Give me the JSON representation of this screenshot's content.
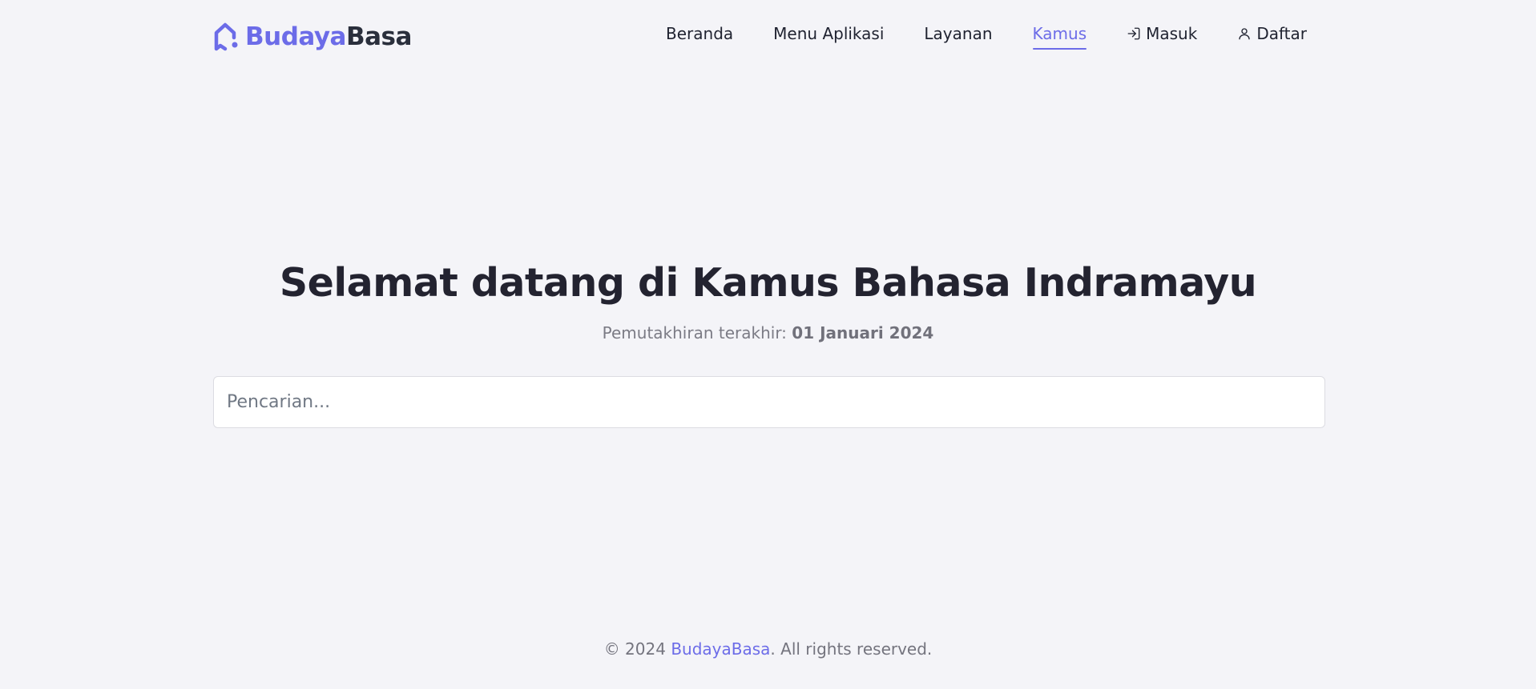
{
  "brand": {
    "part1": "Budaya",
    "part2": "Basa",
    "accent_color": "#6c6ce8"
  },
  "nav": {
    "items": [
      {
        "label": "Beranda",
        "active": false
      },
      {
        "label": "Menu Aplikasi",
        "active": false
      },
      {
        "label": "Layanan",
        "active": false
      },
      {
        "label": "Kamus",
        "active": true
      },
      {
        "label": "Masuk",
        "icon": "login-icon",
        "active": false
      },
      {
        "label": "Daftar",
        "icon": "user-icon",
        "active": false
      }
    ]
  },
  "hero": {
    "title": "Selamat datang di Kamus Bahasa Indramayu",
    "subtitle_prefix": "Pemutakhiran terakhir:",
    "subtitle_date": "01 Januari 2024"
  },
  "search": {
    "placeholder": "Pencarian...",
    "value": ""
  },
  "footer": {
    "prefix": "© 2024",
    "brand": "BudayaBasa",
    "suffix": ". All rights reserved."
  }
}
